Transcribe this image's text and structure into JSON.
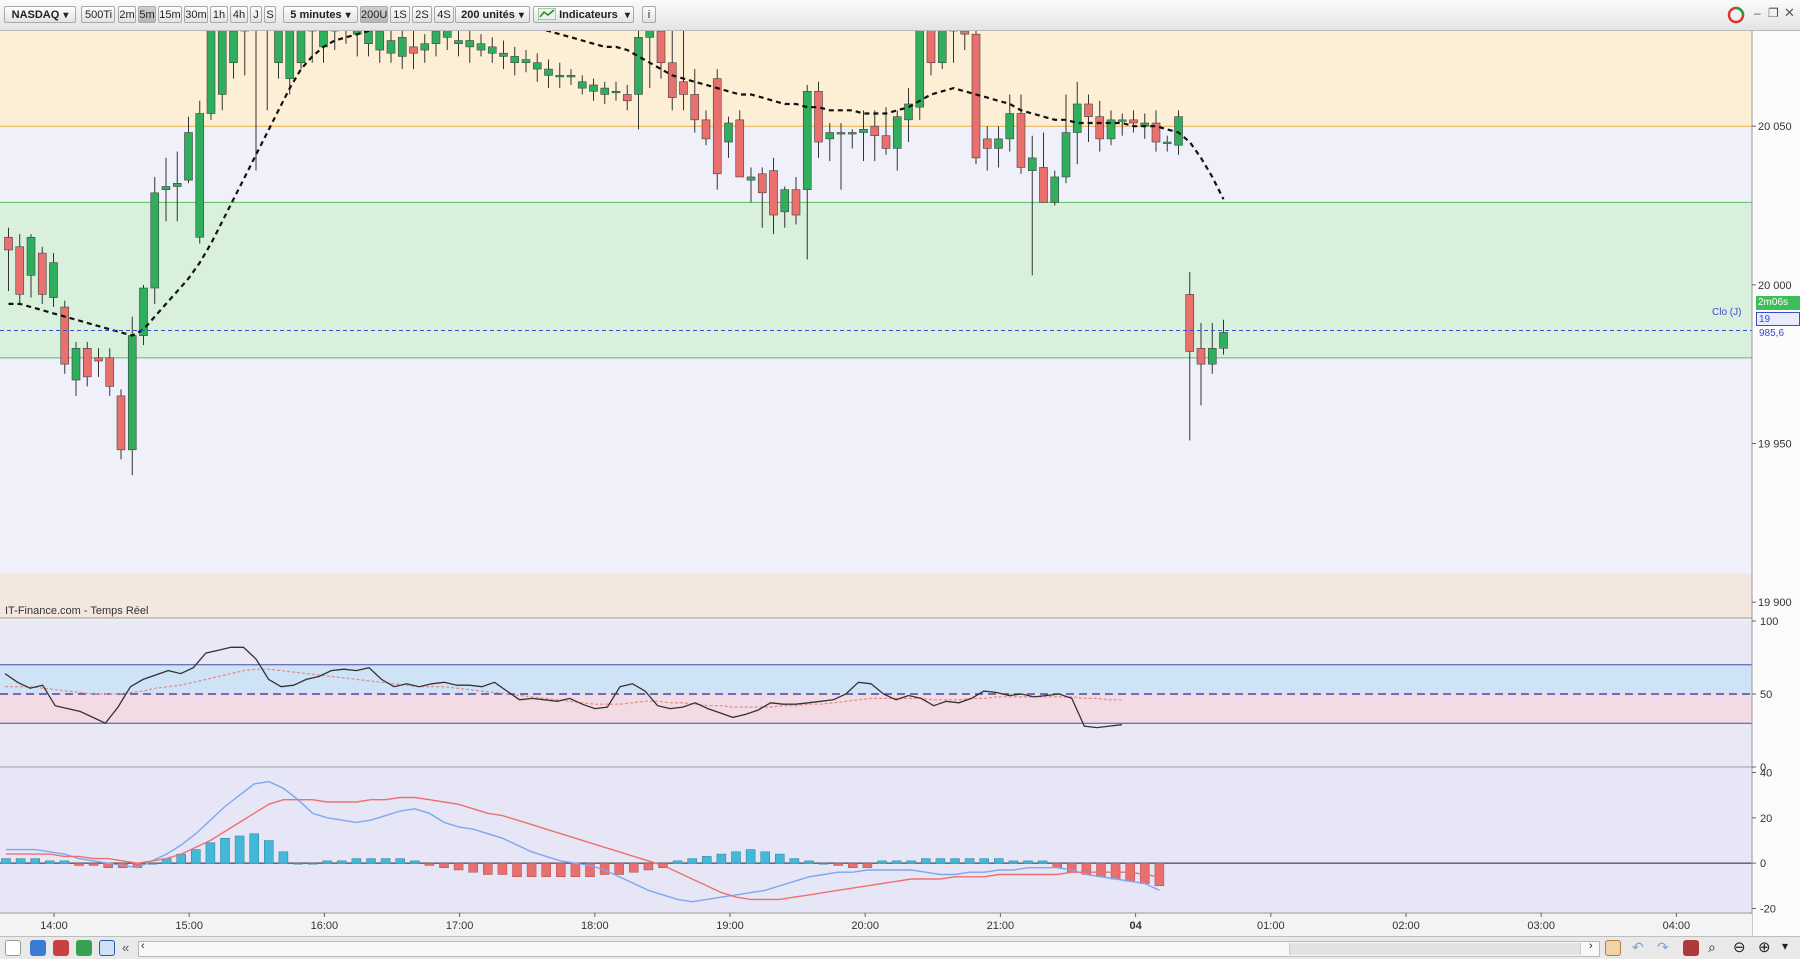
{
  "toolbar": {
    "instrument": "NASDAQ",
    "tick_interval": "500Ti",
    "periods": [
      "2m",
      "5m",
      "15m",
      "30m",
      "1h",
      "4h",
      "J",
      "S"
    ],
    "selected_period": "5m",
    "timeframe": "5 minutes",
    "units_group": [
      "200U",
      "1S",
      "2S",
      "4S"
    ],
    "selected_units": "200U",
    "units": "200 unités",
    "indicators_label": "Indicateurs",
    "info_label": "i"
  },
  "watermark": "IT-Finance.com - Temps Réel",
  "price_axis": {
    "ticks": [
      "20 050",
      "20 000",
      "19 950",
      "19 900"
    ],
    "close_tag": "Clo (J)",
    "timer_badge": "2m06s",
    "last_price_badge": "19 985,6"
  },
  "rsi_axis": {
    "ticks": [
      "100",
      "50",
      "0"
    ]
  },
  "macd_axis": {
    "ticks": [
      "40",
      "20",
      "0",
      "-20"
    ]
  },
  "time_axis": {
    "ticks": [
      "14:00",
      "15:00",
      "16:00",
      "17:00",
      "18:00",
      "19:00",
      "20:00",
      "21:00",
      "04",
      "01:00",
      "02:00",
      "03:00",
      "04:00"
    ]
  },
  "colors": {
    "bull": "#2fae5e",
    "bear": "#e9706c",
    "zone_top": "#fdeed6",
    "zone_mid": "#d9f1dc",
    "zone_bottom": "#f3e7df",
    "rsi_line": "#333333",
    "macd_line": "#7ea7f0",
    "signal_line": "#f07070",
    "hist_pos": "#43b8d8",
    "hist_neg": "#e86f6f"
  },
  "chart_data": {
    "type": "candlestick",
    "price_ylim": [
      19895,
      20080
    ],
    "close_reference": 19985.6,
    "zones": [
      {
        "from": 20050,
        "to": 20080
      },
      {
        "from": 19977,
        "to": 20026
      },
      {
        "from": 19895,
        "to": 19909
      }
    ],
    "candles": [
      [
        20015,
        20011,
        20018,
        19998
      ],
      [
        20012,
        19997,
        20016,
        19994
      ],
      [
        20003,
        20015,
        20016,
        19996
      ],
      [
        20010,
        19997,
        20012,
        19994
      ],
      [
        19996,
        20007,
        20010,
        19993
      ],
      [
        19993,
        19975,
        19995,
        19972
      ],
      [
        19970,
        19980,
        19982,
        19965
      ],
      [
        19980,
        19971,
        19982,
        19968
      ],
      [
        19977,
        19976,
        19980,
        19971
      ],
      [
        19977,
        19968,
        19980,
        19965
      ],
      [
        19965,
        19948,
        19967,
        19945
      ],
      [
        19948,
        19984,
        19990,
        19940
      ],
      [
        19984,
        19999,
        20000,
        19981
      ],
      [
        19999,
        20029,
        20034,
        19994
      ],
      [
        20030,
        20031,
        20040,
        20020
      ],
      [
        20031,
        20032,
        20042,
        20020
      ],
      [
        20033,
        20048,
        20053,
        20032
      ],
      [
        20015,
        20054,
        20058,
        20013
      ],
      [
        20054,
        20090,
        20095,
        20052
      ],
      [
        20060,
        20085,
        20090,
        20055
      ],
      [
        20070,
        20080,
        20088,
        20065
      ],
      [
        20080,
        20088,
        20094,
        20066
      ],
      [
        20088,
        20084,
        20090,
        20036
      ],
      [
        20084,
        20090,
        20095,
        20055
      ],
      [
        20070,
        20090,
        20095,
        20065
      ],
      [
        20065,
        20085,
        20090,
        20060
      ],
      [
        20070,
        20088,
        20095,
        20068
      ],
      [
        20080,
        20090,
        20094,
        20070
      ],
      [
        20075,
        20080,
        20088,
        20070
      ],
      [
        20080,
        20090,
        20094,
        20074
      ],
      [
        20082,
        20086,
        20090,
        20076
      ],
      [
        20079,
        20084,
        20088,
        20072
      ],
      [
        20076,
        20080,
        20086,
        20072
      ],
      [
        20074,
        20080,
        20084,
        20070
      ],
      [
        20073,
        20077,
        20081,
        20070
      ],
      [
        20072,
        20078,
        20082,
        20068
      ],
      [
        20075,
        20073,
        20080,
        20068
      ],
      [
        20074,
        20076,
        20079,
        20070
      ],
      [
        20076,
        20080,
        20085,
        20072
      ],
      [
        20078,
        20082,
        20086,
        20074
      ],
      [
        20076,
        20077,
        20082,
        20072
      ],
      [
        20075,
        20077,
        20080,
        20070
      ],
      [
        20074,
        20076,
        20079,
        20072
      ],
      [
        20073,
        20075,
        20078,
        20070
      ],
      [
        20072,
        20073,
        20077,
        20068
      ],
      [
        20070,
        20072,
        20075,
        20066
      ],
      [
        20070,
        20071,
        20074,
        20067
      ],
      [
        20068,
        20070,
        20073,
        20064
      ],
      [
        20066,
        20068,
        20071,
        20062
      ],
      [
        20066,
        20066,
        20070,
        20062
      ],
      [
        20066,
        20066,
        20068,
        20063
      ],
      [
        20062,
        20064,
        20066,
        20060
      ],
      [
        20061,
        20063,
        20065,
        20058
      ],
      [
        20060,
        20062,
        20064,
        20057
      ],
      [
        20061,
        20061,
        20064,
        20058
      ],
      [
        20060,
        20058,
        20063,
        20055
      ],
      [
        20060,
        20078,
        20082,
        20049
      ],
      [
        20078,
        20086,
        20090,
        20062
      ],
      [
        20080,
        20070,
        20090,
        20065
      ],
      [
        20070,
        20059,
        20090,
        20055
      ],
      [
        20064,
        20060,
        20085,
        20055
      ],
      [
        20060,
        20052,
        20068,
        20048
      ],
      [
        20052,
        20046,
        20055,
        20044
      ],
      [
        20065,
        20035,
        20068,
        20030
      ],
      [
        20045,
        20051,
        20053,
        20040
      ],
      [
        20052,
        20034,
        20055,
        20034
      ],
      [
        20033,
        20034,
        20037,
        20026
      ],
      [
        20035,
        20029,
        20037,
        20018
      ],
      [
        20036,
        20022,
        20040,
        20016
      ],
      [
        20023,
        20030,
        20031,
        20018
      ],
      [
        20030,
        20022,
        20034,
        20019
      ],
      [
        20030,
        20061,
        20063,
        20008
      ],
      [
        20061,
        20045,
        20064,
        20040
      ],
      [
        20046,
        20048,
        20051,
        20039
      ],
      [
        20048,
        20048,
        20051,
        20030
      ],
      [
        20048,
        20048,
        20049,
        20043
      ],
      [
        20048,
        20049,
        20055,
        20039
      ],
      [
        20050,
        20047,
        20055,
        20039
      ],
      [
        20047,
        20043,
        20056,
        20041
      ],
      [
        20043,
        20053,
        20055,
        20036
      ],
      [
        20052,
        20057,
        20062,
        20045
      ],
      [
        20056,
        20085,
        20090,
        20052
      ],
      [
        20085,
        20070,
        20092,
        20066
      ],
      [
        20070,
        20082,
        20088,
        20068
      ],
      [
        20082,
        20080,
        20085,
        20070
      ],
      [
        20080,
        20079,
        20086,
        20074
      ],
      [
        20079,
        20040,
        20088,
        20038
      ],
      [
        20046,
        20043,
        20050,
        20036
      ],
      [
        20043,
        20046,
        20050,
        20037
      ],
      [
        20046,
        20054,
        20060,
        20042
      ],
      [
        20054,
        20037,
        20060,
        20035
      ],
      [
        20036,
        20040,
        20047,
        20003
      ],
      [
        20037,
        20026,
        20048,
        20026
      ],
      [
        20026,
        20034,
        20036,
        20025
      ],
      [
        20034,
        20048,
        20060,
        20032
      ],
      [
        20048,
        20057,
        20064,
        20038
      ],
      [
        20057,
        20053,
        20060,
        20045
      ],
      [
        20053,
        20046,
        20058,
        20042
      ],
      [
        20046,
        20052,
        20055,
        20044
      ],
      [
        20052,
        20052,
        20054,
        20047
      ],
      [
        20052,
        20051,
        20055,
        20048
      ],
      [
        20050,
        20051,
        20054,
        20046
      ],
      [
        20051,
        20045,
        20055,
        20042
      ],
      [
        20045,
        20045,
        20047,
        20042
      ],
      [
        20044,
        20053,
        20055,
        20041
      ],
      [
        19997,
        19979,
        20004,
        19951
      ],
      [
        19980,
        19975,
        19988,
        19962
      ],
      [
        19975,
        19980,
        19988,
        19972
      ],
      [
        19980,
        19985,
        19989,
        19978
      ]
    ],
    "moving_average": [
      19994,
      19994,
      19993,
      19992,
      19991,
      19990,
      19989,
      19988,
      19987,
      19986,
      19985,
      19984,
      19986,
      19990,
      19994,
      19998,
      20002,
      20007,
      20013,
      20020,
      20027,
      20034,
      20041,
      20048,
      20055,
      20062,
      20068,
      20072,
      20075,
      20077,
      20078,
      20079,
      20080,
      20081,
      20082,
      20083,
      20084,
      20085,
      20086,
      20087,
      20088,
      20087,
      20086,
      20085,
      20084,
      20083,
      20082,
      20081,
      20080,
      20079,
      20078,
      20077,
      20076,
      20075,
      20075,
      20074,
      20072,
      20070,
      20068,
      20066,
      20065,
      20064,
      20063,
      20062,
      20061,
      20060,
      20060,
      20059,
      20058,
      20057,
      20057,
      20056,
      20056,
      20055,
      20055,
      20055,
      20054,
      20054,
      20054,
      20055,
      20056,
      20058,
      20060,
      20061,
      20062,
      20061,
      20060,
      20059,
      20058,
      20057,
      20055,
      20054,
      20053,
      20052,
      20052,
      20051,
      20051,
      20051,
      20051,
      20051,
      20050,
      20050,
      20050,
      20049,
      20048,
      20045,
      20040,
      20034,
      20027
    ],
    "rsi": {
      "ylim": [
        0,
        100
      ],
      "levels": [
        70,
        50,
        30
      ],
      "values": [
        64,
        58,
        54,
        56,
        42,
        40,
        38,
        34,
        30,
        41,
        55,
        60,
        63,
        66,
        64,
        68,
        78,
        80,
        82,
        82,
        74,
        60,
        55,
        56,
        60,
        62,
        66,
        67,
        66,
        68,
        60,
        55,
        57,
        55,
        57,
        58,
        56,
        56,
        55,
        58,
        52,
        46,
        47,
        46,
        45,
        47,
        43,
        40,
        41,
        55,
        57,
        52,
        42,
        40,
        41,
        44,
        40,
        37,
        34,
        36,
        39,
        44,
        43,
        43,
        44,
        45,
        46,
        50,
        58,
        57,
        50,
        46,
        49,
        47,
        42,
        45,
        44,
        47,
        52,
        51,
        49,
        50,
        48,
        49,
        50,
        47,
        28,
        27,
        28,
        29
      ],
      "signal": [
        55,
        55,
        55,
        54,
        53,
        52,
        51,
        50,
        50,
        50,
        51,
        52,
        54,
        55,
        56,
        58,
        60,
        62,
        64,
        66,
        67,
        67,
        66,
        65,
        64,
        63,
        62,
        61,
        60,
        59,
        58,
        57,
        56,
        55,
        55,
        55,
        54,
        53,
        52,
        51,
        50,
        49,
        48,
        47,
        46,
        45,
        44,
        43,
        43,
        43,
        44,
        45,
        45,
        44,
        44,
        43,
        42,
        42,
        41,
        41,
        41,
        41,
        42,
        42,
        43,
        43,
        44,
        45,
        46,
        47,
        47,
        47,
        47,
        47,
        46,
        46,
        46,
        47,
        47,
        48,
        48,
        48,
        48,
        48,
        48,
        48,
        47,
        47,
        46,
        46
      ]
    },
    "macd": {
      "ylim": [
        -22,
        42
      ],
      "macd_line": [
        6,
        6,
        6,
        5,
        4,
        2,
        1,
        0,
        -1,
        -2,
        1,
        4,
        8,
        13,
        19,
        25,
        30,
        35,
        36,
        33,
        28,
        22,
        20,
        19,
        18,
        19,
        21,
        23,
        24,
        22,
        18,
        16,
        15,
        13,
        11,
        8,
        5,
        3,
        1,
        0,
        -1,
        -3,
        -6,
        -9,
        -12,
        -14,
        -16,
        -17,
        -16,
        -15,
        -14,
        -13,
        -12,
        -10,
        -8,
        -6,
        -5,
        -4,
        -4,
        -3,
        -3,
        -3,
        -3,
        -4,
        -5,
        -5,
        -4,
        -4,
        -3,
        -3,
        -2,
        -2,
        -2,
        -3,
        -5,
        -6,
        -7,
        -8,
        -9,
        -12
      ],
      "signal_line": [
        4,
        4,
        4,
        4,
        3,
        3,
        2,
        2,
        1,
        0,
        1,
        2,
        4,
        7,
        10,
        14,
        18,
        22,
        26,
        28,
        28,
        28,
        27,
        27,
        27,
        28,
        28,
        29,
        29,
        28,
        27,
        26,
        24,
        22,
        21,
        19,
        17,
        15,
        13,
        11,
        9,
        7,
        5,
        3,
        1,
        -1,
        -4,
        -7,
        -10,
        -13,
        -15,
        -16,
        -16,
        -16,
        -15,
        -14,
        -13,
        -12,
        -11,
        -10,
        -9,
        -8,
        -7,
        -7,
        -7,
        -6,
        -6,
        -6,
        -5,
        -5,
        -5,
        -5,
        -5,
        -4,
        -4,
        -4,
        -4,
        -4,
        -5,
        -6
      ],
      "histogram": [
        2,
        2,
        2,
        1,
        1,
        -1,
        -1,
        -2,
        -2,
        -2,
        0,
        2,
        4,
        6,
        9,
        11,
        12,
        13,
        10,
        5,
        0,
        0,
        1,
        1,
        2,
        2,
        2,
        2,
        1,
        -1,
        -2,
        -3,
        -4,
        -5,
        -5,
        -6,
        -6,
        -6,
        -6,
        -6,
        -6,
        -5,
        -5,
        -4,
        -3,
        -2,
        1,
        2,
        3,
        4,
        5,
        6,
        5,
        4,
        2,
        1,
        0,
        -1,
        -2,
        -2,
        1,
        1,
        1,
        2,
        2,
        2,
        2,
        2,
        2,
        1,
        1,
        1,
        -2,
        -4,
        -5,
        -6,
        -7,
        -8,
        -9,
        -10
      ]
    }
  }
}
